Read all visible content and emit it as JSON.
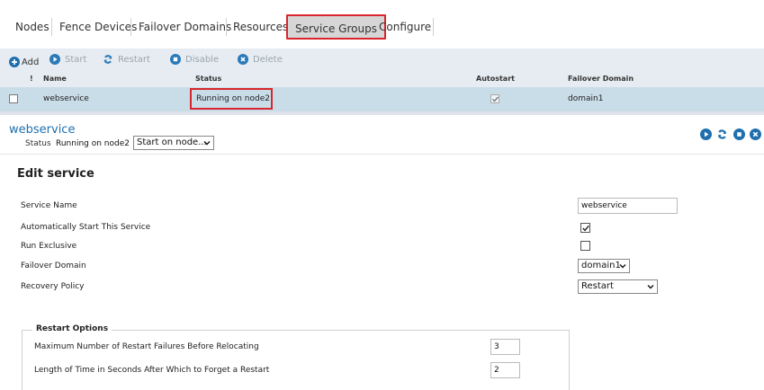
{
  "nav": {
    "tabs": [
      "Nodes",
      "Fence Devices",
      "Failover Domains",
      "Resources",
      "Service Groups",
      "Configure"
    ],
    "active": "Service Groups"
  },
  "toolbar": {
    "add": "Add",
    "start": "Start",
    "restart": "Restart",
    "disable": "Disable",
    "delete": "Delete"
  },
  "table": {
    "headers": {
      "flag": "!",
      "name": "Name",
      "status": "Status",
      "autostart": "Autostart",
      "failover_domain": "Failover Domain"
    },
    "rows": [
      {
        "name": "webservice",
        "status": "Running on node2",
        "autostart": true,
        "failover_domain": "domain1"
      }
    ]
  },
  "service": {
    "title": "webservice",
    "status_label": "Status",
    "status_value": "Running on node2",
    "action_select": "Start on node..."
  },
  "edit": {
    "title": "Edit service",
    "service_name_label": "Service Name",
    "service_name_value": "webservice",
    "autostart_label": "Automatically Start This Service",
    "autostart_checked": true,
    "run_exclusive_label": "Run Exclusive",
    "run_exclusive_checked": false,
    "failover_domain_label": "Failover Domain",
    "failover_domain_value": "domain1",
    "recovery_policy_label": "Recovery Policy",
    "recovery_policy_value": "Restart"
  },
  "restart_options": {
    "legend": "Restart Options",
    "max_failures_label": "Maximum Number of Restart Failures Before Relocating",
    "max_failures_value": "3",
    "forget_label": "Length of Time in Seconds After Which to Forget a Restart",
    "forget_value": "2"
  },
  "colors": {
    "accent": "#1f6fae",
    "highlight_border": "#d9262c",
    "selected_row": "#c9dde9",
    "toolbar_bg": "#e6ecf1"
  }
}
